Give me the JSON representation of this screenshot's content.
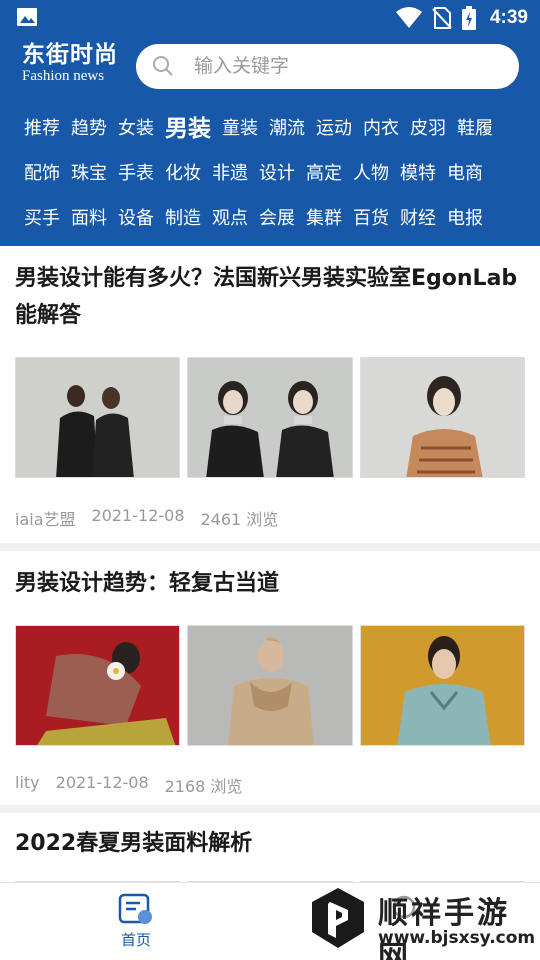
{
  "status_bar": {
    "time": "4:39"
  },
  "header": {
    "logo_cn": "东街时尚",
    "logo_en": "Fashion news",
    "search_placeholder": "输入关键字"
  },
  "categories": {
    "row1": [
      "推荐",
      "趋势",
      "女装",
      "男装",
      "童装",
      "潮流",
      "运动",
      "内衣",
      "皮羽",
      "鞋履"
    ],
    "row2": [
      "配饰",
      "珠宝",
      "手表",
      "化妆",
      "非遗",
      "设计",
      "高定",
      "人物",
      "模特",
      "电商"
    ],
    "row3": [
      "买手",
      "面料",
      "设备",
      "制造",
      "观点",
      "会展",
      "集群",
      "百货",
      "财经",
      "电报"
    ],
    "active": "男装"
  },
  "articles": [
    {
      "title": "男装设计能有多火？法国新兴男装实验室EgonLab能解答",
      "source": "iaia艺盟",
      "date": "2021-12-08",
      "views": "2461 浏览"
    },
    {
      "title": "男装设计趋势：轻复古当道",
      "source": "lity",
      "date": "2021-12-08",
      "views": "2168 浏览"
    },
    {
      "title": "2022春夏男装面料解析"
    }
  ],
  "bottom_nav": {
    "home_label": "首页"
  },
  "watermark": {
    "text": "顺祥手游网",
    "url": "www.bjsxsy.com"
  },
  "colors": {
    "brand": "#1858a8",
    "active_nav": "#1858a8"
  }
}
